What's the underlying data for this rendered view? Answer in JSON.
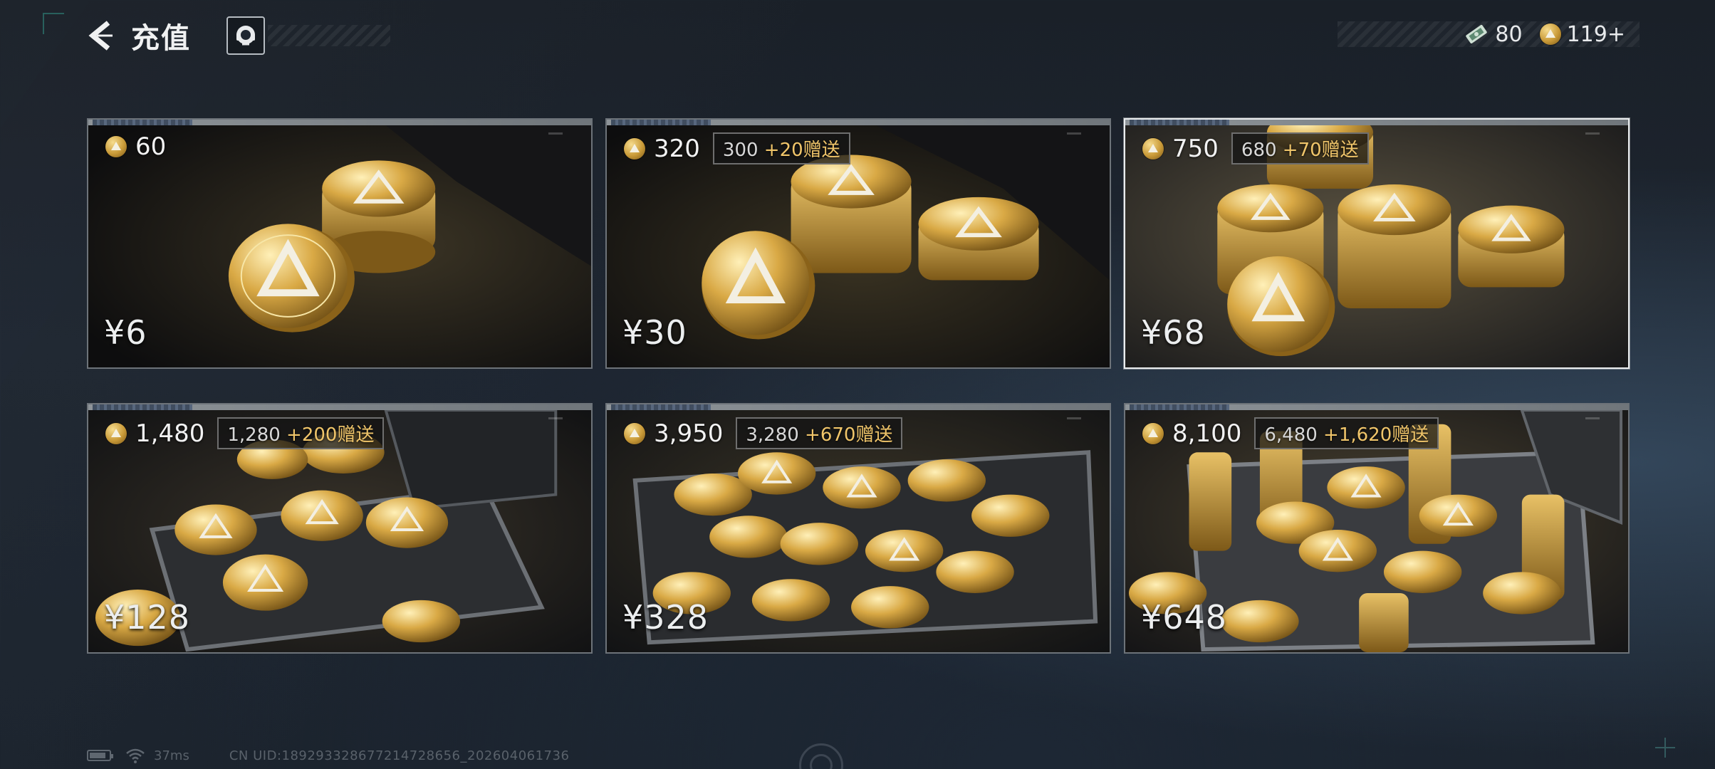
{
  "header": {
    "title": "充值",
    "back_icon": "chevron-left-icon",
    "support_icon": "headset-icon"
  },
  "currency": {
    "ticket_value": "80",
    "coin_value": "119+"
  },
  "packages": [
    {
      "amount": "60",
      "bonus_base": "",
      "bonus_extra": "",
      "price": "¥6",
      "selected": false
    },
    {
      "amount": "320",
      "bonus_base": "300 ",
      "bonus_extra": "+20赠送",
      "price": "¥30",
      "selected": false
    },
    {
      "amount": "750",
      "bonus_base": "680 ",
      "bonus_extra": "+70赠送",
      "price": "¥68",
      "selected": true
    },
    {
      "amount": "1,480",
      "bonus_base": "1,280 ",
      "bonus_extra": "+200赠送",
      "price": "¥128",
      "selected": false
    },
    {
      "amount": "3,950",
      "bonus_base": "3,280 ",
      "bonus_extra": "+670赠送",
      "price": "¥328",
      "selected": false
    },
    {
      "amount": "8,100",
      "bonus_base": "6,480 ",
      "bonus_extra": "+1,620赠送",
      "price": "¥648",
      "selected": false
    }
  ],
  "footer": {
    "ping": "37ms",
    "uid": "CN UID:18929332867721472​8656_202604061736"
  },
  "colors": {
    "accent_gold": "#f0c56a",
    "selected_border": "#e9ecee",
    "background": "#1e2631"
  }
}
